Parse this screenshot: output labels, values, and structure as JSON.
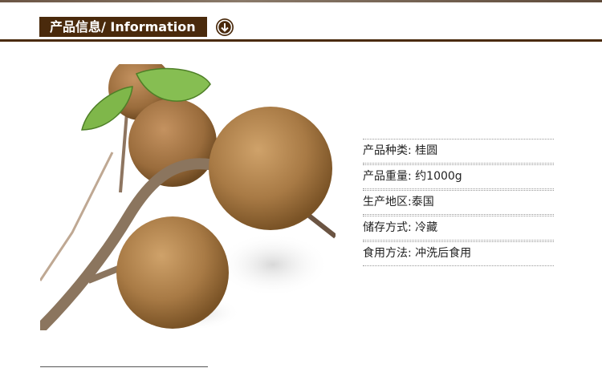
{
  "header": {
    "title": "产品信息/ Information",
    "icon": "arrow-down-circle-icon"
  },
  "colors": {
    "accent": "#4a2a0c"
  },
  "specs": [
    {
      "text": "产品种类: 桂圆"
    },
    {
      "text": "产品重量: 约1000g"
    },
    {
      "text": "生产地区:泰国"
    },
    {
      "text": "储存方式: 冷藏"
    },
    {
      "text": "食用方法: 冲洗后食用"
    }
  ]
}
